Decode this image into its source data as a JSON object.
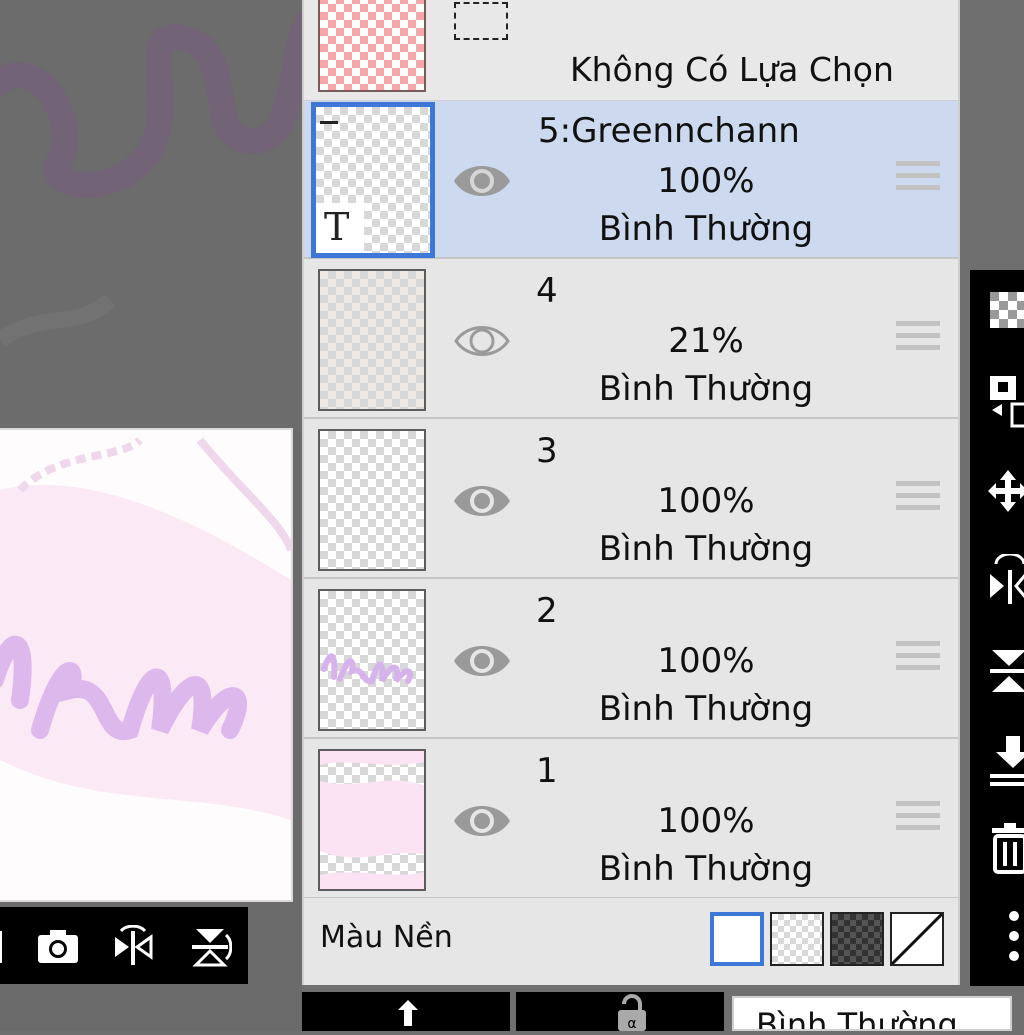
{
  "selection": {
    "label": "Không Có Lựa Chọn"
  },
  "layers": [
    {
      "name": "5:Greennchann",
      "opacity": "100%",
      "blend": "Bình Thường",
      "visible": true,
      "selected": true,
      "type": "text",
      "thumb_glyph": "T"
    },
    {
      "name": "4",
      "opacity": "21%",
      "blend": "Bình Thường",
      "visible": true,
      "selected": false
    },
    {
      "name": "3",
      "opacity": "100%",
      "blend": "Bình Thường",
      "visible": true,
      "selected": false
    },
    {
      "name": "2",
      "opacity": "100%",
      "blend": "Bình Thường",
      "visible": true,
      "selected": false
    },
    {
      "name": "1",
      "opacity": "100%",
      "blend": "Bình Thường",
      "visible": true,
      "selected": false
    }
  ],
  "background": {
    "label": "Màu Nền",
    "options": [
      "white",
      "transparent-light",
      "transparent-dark",
      "none"
    ],
    "selected": "white"
  },
  "bottom_bar": {
    "blend_mode_value": "Bình Thường"
  },
  "colors": {
    "selected_row": "#cdd9ee",
    "selected_border": "#3d78d8",
    "panel_bg": "#e6e6e6",
    "toolbar_bg": "#000000"
  }
}
